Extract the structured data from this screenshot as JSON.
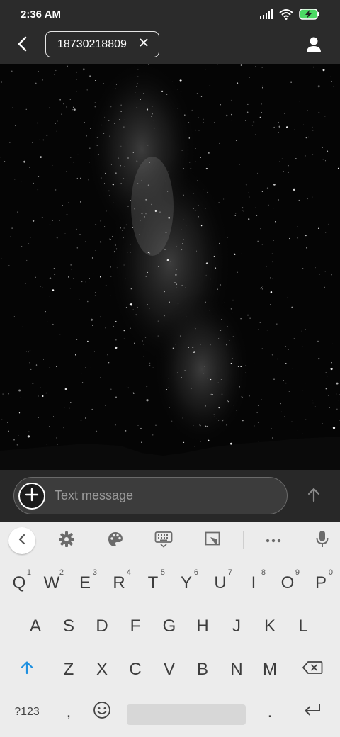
{
  "status_bar": {
    "time": "2:36 AM",
    "icons": [
      "signal-icon",
      "wifi-icon",
      "battery-charging-icon"
    ],
    "battery_color": "#4cd964"
  },
  "top_bar": {
    "recipient": "18730218809",
    "back_icon": "chevron-left-icon",
    "remove_icon": "close-icon",
    "contact_icon": "person-icon"
  },
  "compose": {
    "placeholder": "Text message",
    "value": "",
    "attach_icon": "plus-icon",
    "send_icon": "arrow-up-icon"
  },
  "keyboard": {
    "toolbar": [
      "chevron-left-icon",
      "gear-icon",
      "palette-icon",
      "keyboard-icon",
      "resize-icon",
      "more-icon",
      "mic-icon"
    ],
    "row1": [
      {
        "key": "Q",
        "hint": "1"
      },
      {
        "key": "W",
        "hint": "2"
      },
      {
        "key": "E",
        "hint": "3"
      },
      {
        "key": "R",
        "hint": "4"
      },
      {
        "key": "T",
        "hint": "5"
      },
      {
        "key": "Y",
        "hint": "6"
      },
      {
        "key": "U",
        "hint": "7"
      },
      {
        "key": "I",
        "hint": "8"
      },
      {
        "key": "O",
        "hint": "9"
      },
      {
        "key": "P",
        "hint": "0"
      }
    ],
    "row2": [
      "A",
      "S",
      "D",
      "F",
      "G",
      "H",
      "J",
      "K",
      "L"
    ],
    "row3": [
      "Z",
      "X",
      "C",
      "V",
      "B",
      "N",
      "M"
    ],
    "row4": {
      "symbols": "?123",
      "comma": ",",
      "period": "."
    },
    "accent_color": "#1e90e0"
  }
}
